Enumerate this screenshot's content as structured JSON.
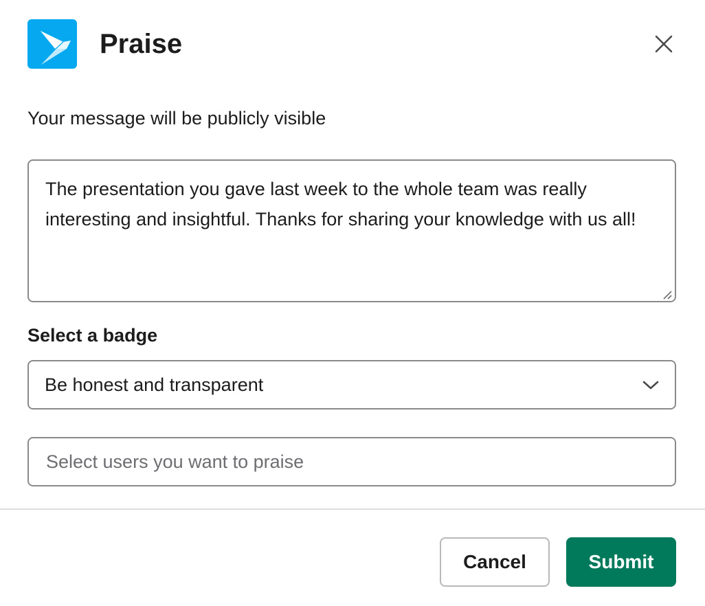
{
  "modal": {
    "title": "Praise",
    "notice": "Your message will be publicly visible",
    "message": "The presentation you gave last week to the whole team was really interesting and insightful. Thanks for sharing your knowledge with us all!",
    "badge_label": "Select a badge",
    "badge_selected": "Be honest and transparent",
    "users_placeholder": "Select users you want to praise",
    "cancel_label": "Cancel",
    "submit_label": "Submit"
  },
  "icons": {
    "logo": "paper-plane-logo-icon",
    "close": "close-icon",
    "dropdown": "chevron-down-icon",
    "resize": "resize-handle-icon"
  },
  "colors": {
    "logo_bg": "#06a9f0",
    "submit_bg": "#007a5a",
    "text": "#1d1c1d",
    "border": "#8a8a8d",
    "placeholder": "#6e6e72"
  }
}
